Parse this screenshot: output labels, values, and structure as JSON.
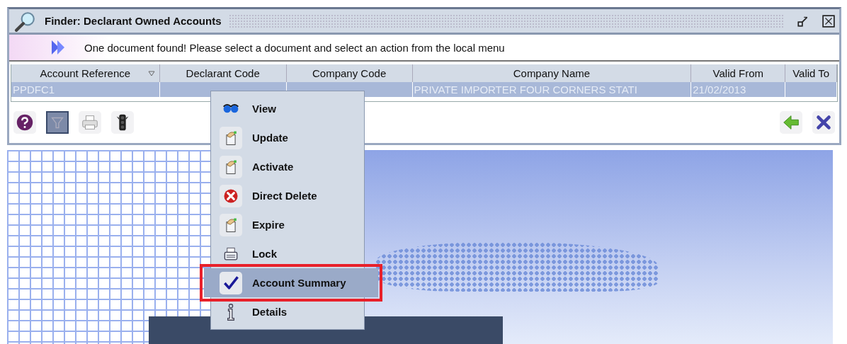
{
  "window": {
    "title": "Finder: Declarant Owned Accounts"
  },
  "message": "One document found! Please select a document and select an action from the local menu",
  "table": {
    "columns": [
      {
        "label": "Account Reference",
        "sorted": true
      },
      {
        "label": "Declarant Code",
        "sorted": false
      },
      {
        "label": "Company Code",
        "sorted": false
      },
      {
        "label": "Company Name",
        "sorted": false
      },
      {
        "label": "Valid From",
        "sorted": false
      },
      {
        "label": "Valid To",
        "sorted": false
      }
    ],
    "rows": [
      {
        "selected": true,
        "cells": [
          "PPDFC1",
          null,
          null,
          "PRIVATE IMPORTER FOUR CORNERS STATI",
          "21/02/2013",
          null
        ]
      }
    ]
  },
  "toolbar": {
    "left": [
      {
        "kind": "help",
        "pressed": false
      },
      {
        "kind": "filter",
        "pressed": true
      },
      {
        "kind": "print",
        "pressed": false
      },
      {
        "kind": "traffic",
        "pressed": false
      }
    ],
    "right": [
      {
        "kind": "back",
        "pressed": false
      },
      {
        "kind": "close",
        "pressed": false
      }
    ]
  },
  "context_menu": [
    {
      "label": "View",
      "kind": "view",
      "selected": false,
      "annotated": false
    },
    {
      "label": "Update",
      "kind": "edit",
      "selected": false,
      "annotated": false
    },
    {
      "label": "Activate",
      "kind": "edit",
      "selected": false,
      "annotated": false
    },
    {
      "label": "Direct Delete",
      "kind": "delete",
      "selected": false,
      "annotated": false
    },
    {
      "label": "Expire",
      "kind": "edit",
      "selected": false,
      "annotated": false
    },
    {
      "label": "Lock",
      "kind": "lock",
      "selected": false,
      "annotated": false
    },
    {
      "label": "Account Summary",
      "kind": "check",
      "selected": true,
      "annotated": true
    },
    {
      "label": "Details",
      "kind": "info",
      "selected": false,
      "annotated": false
    }
  ]
}
